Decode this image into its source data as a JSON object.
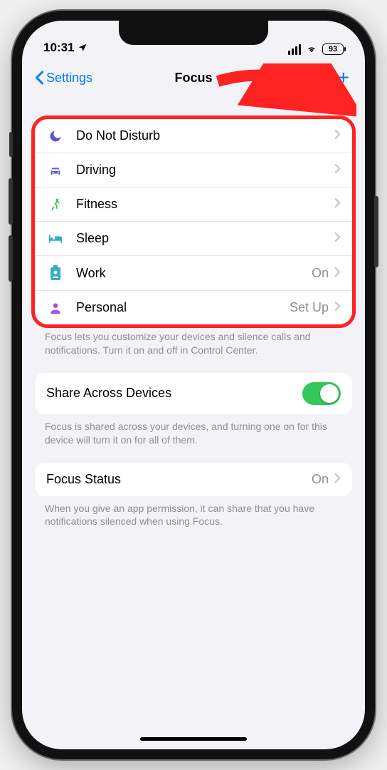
{
  "status": {
    "time": "10:31",
    "battery": "93"
  },
  "nav": {
    "back": "Settings",
    "title": "Focus",
    "add": "+"
  },
  "focus_list": [
    {
      "id": "dnd",
      "label": "Do Not Disturb",
      "detail": "",
      "icon_color": "#5856d6"
    },
    {
      "id": "driving",
      "label": "Driving",
      "detail": "",
      "icon_color": "#5856d6"
    },
    {
      "id": "fitness",
      "label": "Fitness",
      "detail": "",
      "icon_color": "#34c759"
    },
    {
      "id": "sleep",
      "label": "Sleep",
      "detail": "",
      "icon_color": "#30b0c7"
    },
    {
      "id": "work",
      "label": "Work",
      "detail": "On",
      "icon_color": "#30b0c7"
    },
    {
      "id": "personal",
      "label": "Personal",
      "detail": "Set Up",
      "icon_color": "#af52de"
    }
  ],
  "footer1": "Focus lets you customize your devices and silence calls and notifications. Turn it on and off in Control Center.",
  "share": {
    "label": "Share Across Devices",
    "on": true
  },
  "footer2": "Focus is shared across your devices, and turning one on for this device will turn it on for all of them.",
  "status_row": {
    "label": "Focus Status",
    "detail": "On"
  },
  "footer3": "When you give an app permission, it can share that you have notifications silenced when using Focus."
}
